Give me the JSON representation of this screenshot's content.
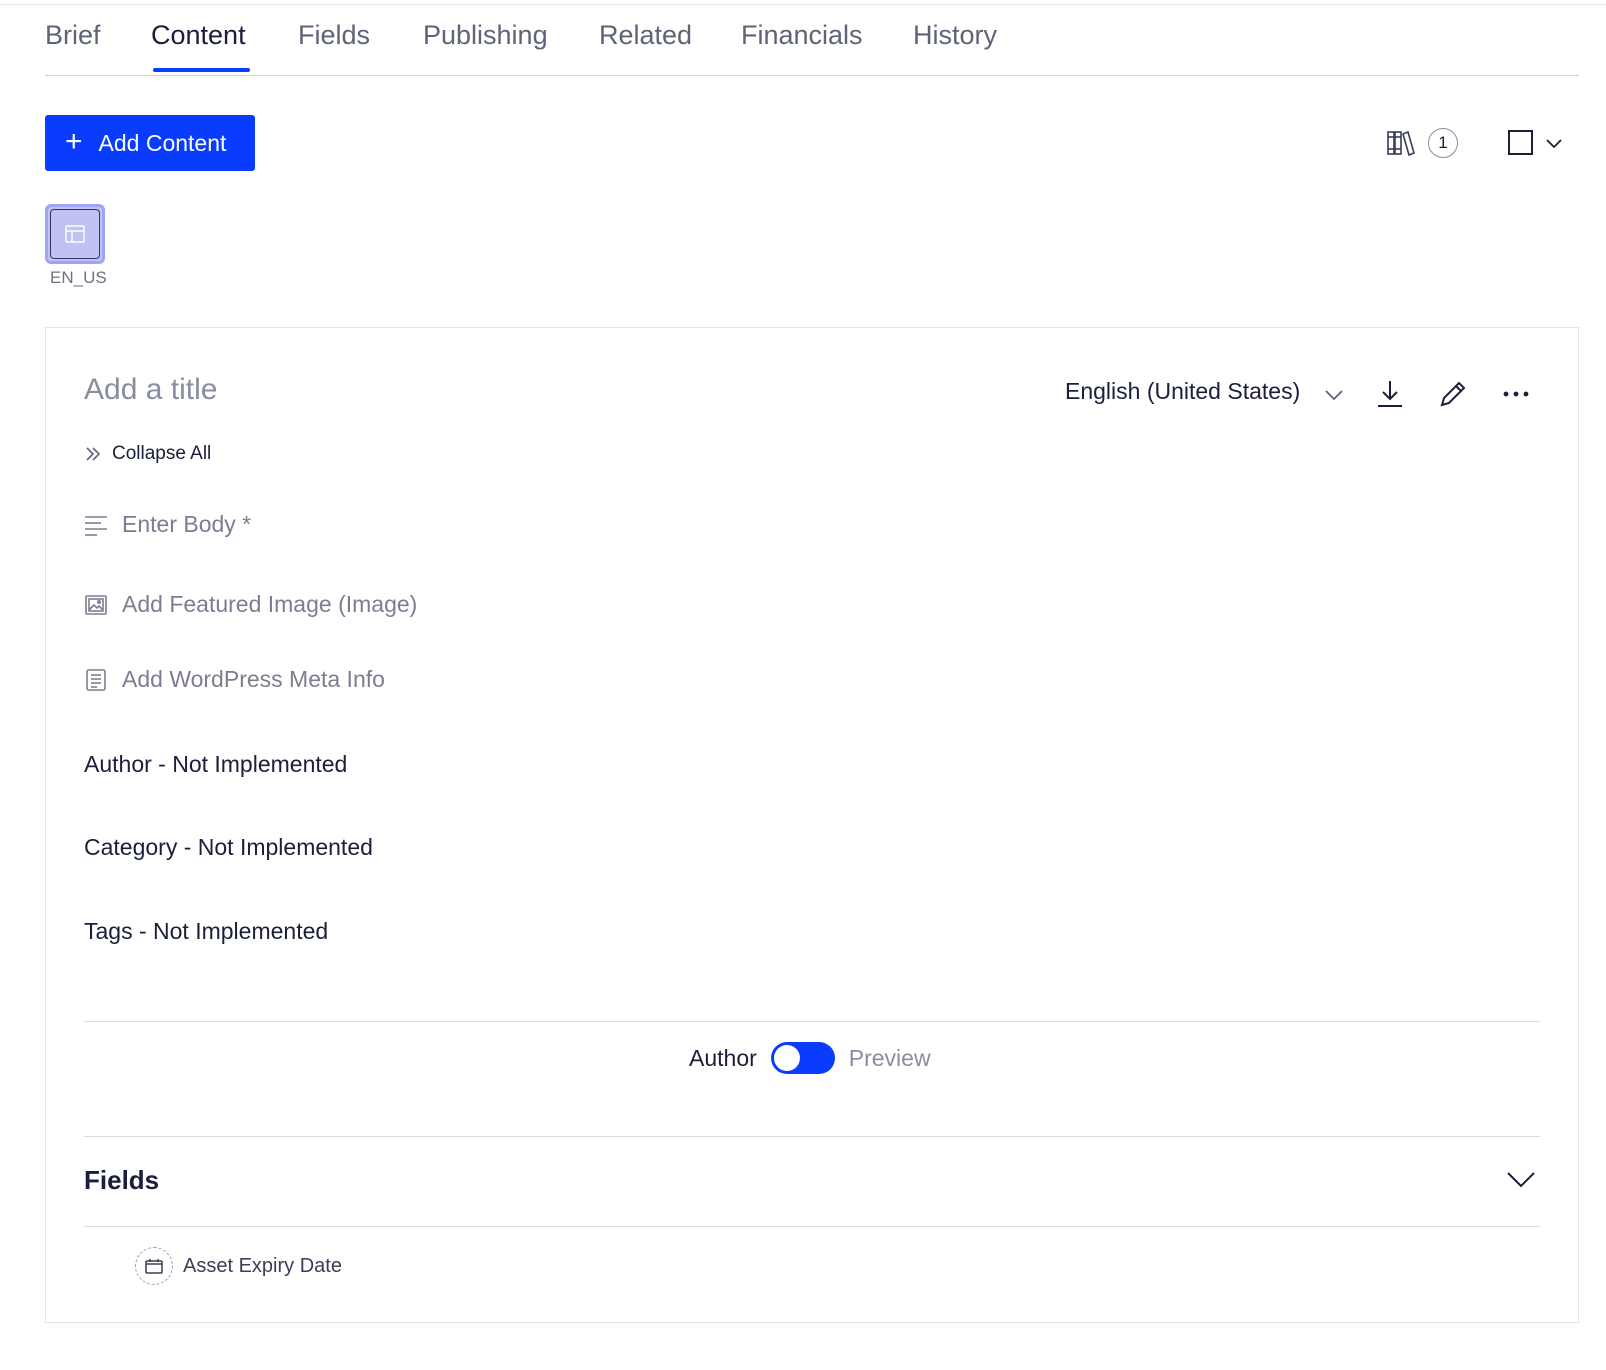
{
  "tabs": [
    {
      "label": "Brief"
    },
    {
      "label": "Content"
    },
    {
      "label": "Fields"
    },
    {
      "label": "Publishing"
    },
    {
      "label": "Related"
    },
    {
      "label": "Financials"
    },
    {
      "label": "History"
    }
  ],
  "active_tab": "Content",
  "toolbar": {
    "add_content_label": "Add Content",
    "library_count": "1",
    "library_icon": "library-books-icon",
    "view_icon": "square-view-icon"
  },
  "locale": {
    "label": "EN_US"
  },
  "editor": {
    "title_placeholder": "Add a title",
    "language": "English (United States)",
    "collapse_label": "Collapse All",
    "body_placeholder": "Enter Body *",
    "featured_image_label": "Add Featured Image (Image)",
    "meta_info_label": "Add WordPress Meta Info",
    "author_row": "Author - Not Implemented",
    "category_row": "Category - Not Implemented",
    "tags_row": "Tags - Not Implemented"
  },
  "mode_toggle": {
    "left_label": "Author",
    "right_label": "Preview",
    "state": "author"
  },
  "fields_section": {
    "heading": "Fields",
    "items": [
      {
        "label": "Asset Expiry Date",
        "icon": "calendar-icon"
      }
    ]
  },
  "colors": {
    "accent": "#0a3cff",
    "text": "#1b1f3b",
    "muted": "#7b7e92"
  }
}
